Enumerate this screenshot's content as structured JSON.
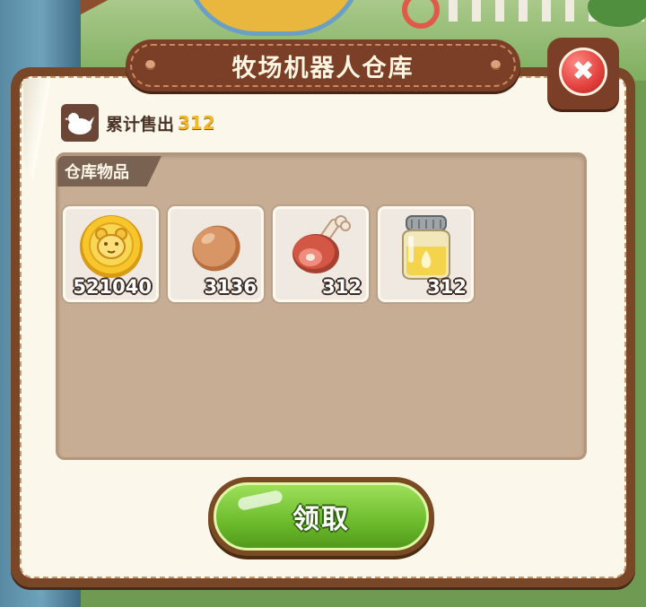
{
  "window": {
    "title": "牧场机器人仓库",
    "close_icon": "close-x-icon"
  },
  "stats": {
    "sold_label": "累计售出",
    "sold_value": "312",
    "icon": "chicken-icon",
    "value_color": "#f2b82c"
  },
  "warehouse": {
    "tab_label": "仓库物品",
    "items": [
      {
        "icon": "gold-coin-icon",
        "count": "521040"
      },
      {
        "icon": "egg-icon",
        "count": "3136"
      },
      {
        "icon": "meat-drumstick-icon",
        "count": "312"
      },
      {
        "icon": "jar-icon",
        "count": "312"
      }
    ]
  },
  "actions": {
    "claim_label": "领取",
    "claim_color": "#6cbb2c"
  },
  "colors": {
    "panel_border": "#7a4628",
    "panel_bg": "#fbf7ea",
    "warehouse_bg": "#c7ad93"
  }
}
